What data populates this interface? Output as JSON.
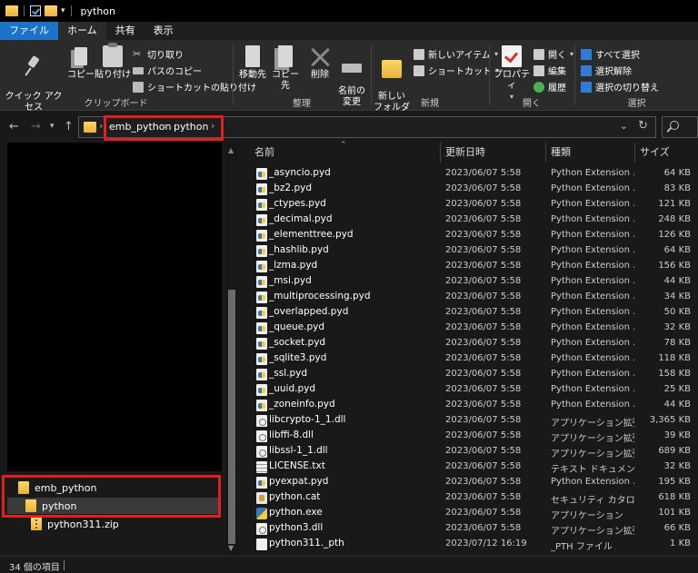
{
  "window": {
    "title": "python"
  },
  "tabs": [
    {
      "label": "ファイル"
    },
    {
      "label": "ホーム"
    },
    {
      "label": "共有"
    },
    {
      "label": "表示"
    }
  ],
  "ribbon": {
    "clipboard": {
      "label": "クリップボード",
      "pin_quick_access": "クイック アクセス\nにピン留めする",
      "copy": "コピー",
      "paste": "貼り付け",
      "cut": "切り取り",
      "copy_path": "パスのコピー",
      "paste_shortcut": "ショートカットの貼り付け"
    },
    "organize": {
      "label": "整理",
      "move_to": "移動先",
      "copy_to": "コピー先",
      "delete": "削除",
      "rename": "名前の\n変更"
    },
    "new": {
      "label": "新規",
      "new_folder": "新しい\nフォルダー",
      "new_item": "新しいアイテム",
      "shortcut": "ショートカット"
    },
    "open": {
      "label": "開く",
      "properties": "プロパティ",
      "open": "開く",
      "edit": "編集",
      "history": "履歴"
    },
    "select": {
      "label": "選択",
      "select_all": "すべて選択",
      "select_none": "選択解除",
      "invert": "選択の切り替え"
    }
  },
  "address": {
    "breadcrumbs": [
      "emb_python",
      "python"
    ]
  },
  "navpane": {
    "items": [
      {
        "label": "emb_python"
      },
      {
        "label": "python"
      },
      {
        "label": "python311.zip"
      }
    ]
  },
  "columns": {
    "name": "名前",
    "date": "更新日時",
    "type": "種類",
    "size": "サイズ"
  },
  "files": [
    {
      "name": "_asyncio.pyd",
      "date": "2023/06/07 5:58",
      "type": "Python Extension ...",
      "size": "64 KB",
      "icon": "pyd"
    },
    {
      "name": "_bz2.pyd",
      "date": "2023/06/07 5:58",
      "type": "Python Extension ...",
      "size": "83 KB",
      "icon": "pyd"
    },
    {
      "name": "_ctypes.pyd",
      "date": "2023/06/07 5:58",
      "type": "Python Extension ...",
      "size": "121 KB",
      "icon": "pyd"
    },
    {
      "name": "_decimal.pyd",
      "date": "2023/06/07 5:58",
      "type": "Python Extension ...",
      "size": "248 KB",
      "icon": "pyd"
    },
    {
      "name": "_elementtree.pyd",
      "date": "2023/06/07 5:58",
      "type": "Python Extension ...",
      "size": "126 KB",
      "icon": "pyd"
    },
    {
      "name": "_hashlib.pyd",
      "date": "2023/06/07 5:58",
      "type": "Python Extension ...",
      "size": "64 KB",
      "icon": "pyd"
    },
    {
      "name": "_lzma.pyd",
      "date": "2023/06/07 5:58",
      "type": "Python Extension ...",
      "size": "156 KB",
      "icon": "pyd"
    },
    {
      "name": "_msi.pyd",
      "date": "2023/06/07 5:58",
      "type": "Python Extension ...",
      "size": "44 KB",
      "icon": "pyd"
    },
    {
      "name": "_multiprocessing.pyd",
      "date": "2023/06/07 5:58",
      "type": "Python Extension ...",
      "size": "34 KB",
      "icon": "pyd"
    },
    {
      "name": "_overlapped.pyd",
      "date": "2023/06/07 5:58",
      "type": "Python Extension ...",
      "size": "50 KB",
      "icon": "pyd"
    },
    {
      "name": "_queue.pyd",
      "date": "2023/06/07 5:58",
      "type": "Python Extension ...",
      "size": "32 KB",
      "icon": "pyd"
    },
    {
      "name": "_socket.pyd",
      "date": "2023/06/07 5:58",
      "type": "Python Extension ...",
      "size": "78 KB",
      "icon": "pyd"
    },
    {
      "name": "_sqlite3.pyd",
      "date": "2023/06/07 5:58",
      "type": "Python Extension ...",
      "size": "118 KB",
      "icon": "pyd"
    },
    {
      "name": "_ssl.pyd",
      "date": "2023/06/07 5:58",
      "type": "Python Extension ...",
      "size": "158 KB",
      "icon": "pyd"
    },
    {
      "name": "_uuid.pyd",
      "date": "2023/06/07 5:58",
      "type": "Python Extension ...",
      "size": "25 KB",
      "icon": "pyd"
    },
    {
      "name": "_zoneinfo.pyd",
      "date": "2023/06/07 5:58",
      "type": "Python Extension ...",
      "size": "44 KB",
      "icon": "pyd"
    },
    {
      "name": "libcrypto-1_1.dll",
      "date": "2023/06/07 5:58",
      "type": "アプリケーション拡張",
      "size": "3,365 KB",
      "icon": "dll"
    },
    {
      "name": "libffi-8.dll",
      "date": "2023/06/07 5:58",
      "type": "アプリケーション拡張",
      "size": "39 KB",
      "icon": "dll"
    },
    {
      "name": "libssl-1_1.dll",
      "date": "2023/06/07 5:58",
      "type": "アプリケーション拡張",
      "size": "689 KB",
      "icon": "dll"
    },
    {
      "name": "LICENSE.txt",
      "date": "2023/06/07 5:58",
      "type": "テキスト ドキュメント",
      "size": "32 KB",
      "icon": "txt"
    },
    {
      "name": "pyexpat.pyd",
      "date": "2023/06/07 5:58",
      "type": "Python Extension ...",
      "size": "195 KB",
      "icon": "pyd"
    },
    {
      "name": "python.cat",
      "date": "2023/06/07 5:58",
      "type": "セキュリティ カタログ",
      "size": "618 KB",
      "icon": "cat"
    },
    {
      "name": "python.exe",
      "date": "2023/06/07 5:58",
      "type": "アプリケーション",
      "size": "101 KB",
      "icon": "exe"
    },
    {
      "name": "python3.dll",
      "date": "2023/06/07 5:58",
      "type": "アプリケーション拡張",
      "size": "66 KB",
      "icon": "dll"
    },
    {
      "name": "python311._pth",
      "date": "2023/07/12 16:19",
      "type": "_PTH ファイル",
      "size": "1 KB",
      "icon": "blank"
    }
  ],
  "status": {
    "count": "34 個の項目"
  }
}
